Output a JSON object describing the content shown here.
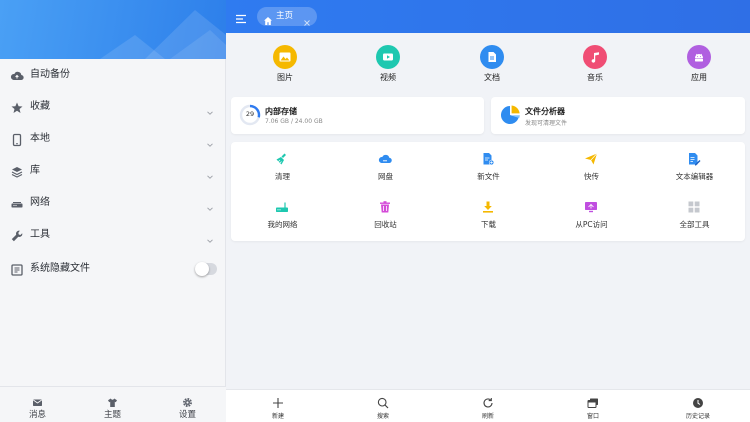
{
  "sidebar": {
    "items": [
      {
        "label": "自动备份",
        "icon": "cloud-upload-icon",
        "has_chevron": false
      },
      {
        "label": "收藏",
        "icon": "star-icon",
        "has_chevron": true
      },
      {
        "label": "本地",
        "icon": "phone-icon",
        "has_chevron": true
      },
      {
        "label": "库",
        "icon": "layers-icon",
        "has_chevron": true
      },
      {
        "label": "网络",
        "icon": "network-icon",
        "has_chevron": true
      },
      {
        "label": "工具",
        "icon": "wrench-icon",
        "has_chevron": true
      },
      {
        "label": "系统隐藏文件",
        "icon": "hidden-files-icon",
        "has_toggle": true,
        "toggle_on": false
      }
    ],
    "bottom_tabs": [
      {
        "label": "消息",
        "icon": "mail-icon"
      },
      {
        "label": "主题",
        "icon": "shirt-icon"
      },
      {
        "label": "设置",
        "icon": "gear-icon"
      }
    ]
  },
  "topbar": {
    "tab_label": "主页",
    "tab_icon": "home-icon"
  },
  "categories": [
    {
      "label": "图片",
      "icon": "image-icon",
      "color": "#f5b800"
    },
    {
      "label": "视频",
      "icon": "video-icon",
      "color": "#1ec8b0"
    },
    {
      "label": "文档",
      "icon": "document-icon",
      "color": "#2f8cf0"
    },
    {
      "label": "音乐",
      "icon": "music-icon",
      "color": "#f04d74"
    },
    {
      "label": "应用",
      "icon": "android-icon",
      "color": "#b05fe0"
    }
  ],
  "storage": {
    "title": "内部存储",
    "usage": "7.06 GB / 24.00 GB",
    "percent_label": "29",
    "percent": 29
  },
  "analyzer": {
    "title": "文件分析器",
    "subtitle": "发现可清理文件"
  },
  "tools": [
    {
      "label": "清理",
      "icon": "broom-icon",
      "color": "#1ec8b0"
    },
    {
      "label": "网盘",
      "icon": "cloud-drive-icon",
      "color": "#2f8cf0"
    },
    {
      "label": "新文件",
      "icon": "new-file-icon",
      "color": "#2f8cf0"
    },
    {
      "label": "快传",
      "icon": "paper-plane-icon",
      "color": "#f5b800"
    },
    {
      "label": "文本编辑器",
      "icon": "text-editor-icon",
      "color": "#2f8cf0"
    },
    {
      "label": "我的网络",
      "icon": "router-icon",
      "color": "#1ec8b0"
    },
    {
      "label": "回收站",
      "icon": "trash-icon",
      "color": "#d44bd8"
    },
    {
      "label": "下载",
      "icon": "download-icon",
      "color": "#f5b800"
    },
    {
      "label": "从PC访问",
      "icon": "pc-access-icon",
      "color": "#c04ee0"
    },
    {
      "label": "全部工具",
      "icon": "all-tools-icon",
      "color": "#c5c8ce"
    }
  ],
  "bottom_bar": [
    {
      "label": "新建",
      "icon": "plus-icon"
    },
    {
      "label": "搜索",
      "icon": "search-icon"
    },
    {
      "label": "刷新",
      "icon": "refresh-icon"
    },
    {
      "label": "窗口",
      "icon": "windows-icon"
    },
    {
      "label": "历史记录",
      "icon": "clock-icon"
    }
  ]
}
